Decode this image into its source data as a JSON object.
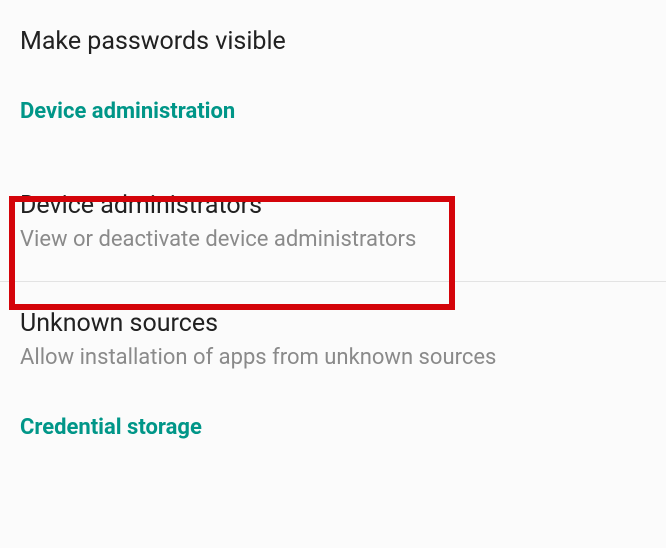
{
  "accent_color": "#009688",
  "highlight_color": "#d4040a",
  "items": {
    "make_passwords_visible": {
      "title": "Make passwords visible"
    },
    "device_administrators": {
      "title": "Device administrators",
      "subtitle": "View or deactivate device administrators"
    },
    "unknown_sources": {
      "title": "Unknown sources",
      "subtitle": "Allow installation of apps from unknown sources"
    }
  },
  "sections": {
    "device_administration": "Device administration",
    "credential_storage": "Credential storage"
  }
}
